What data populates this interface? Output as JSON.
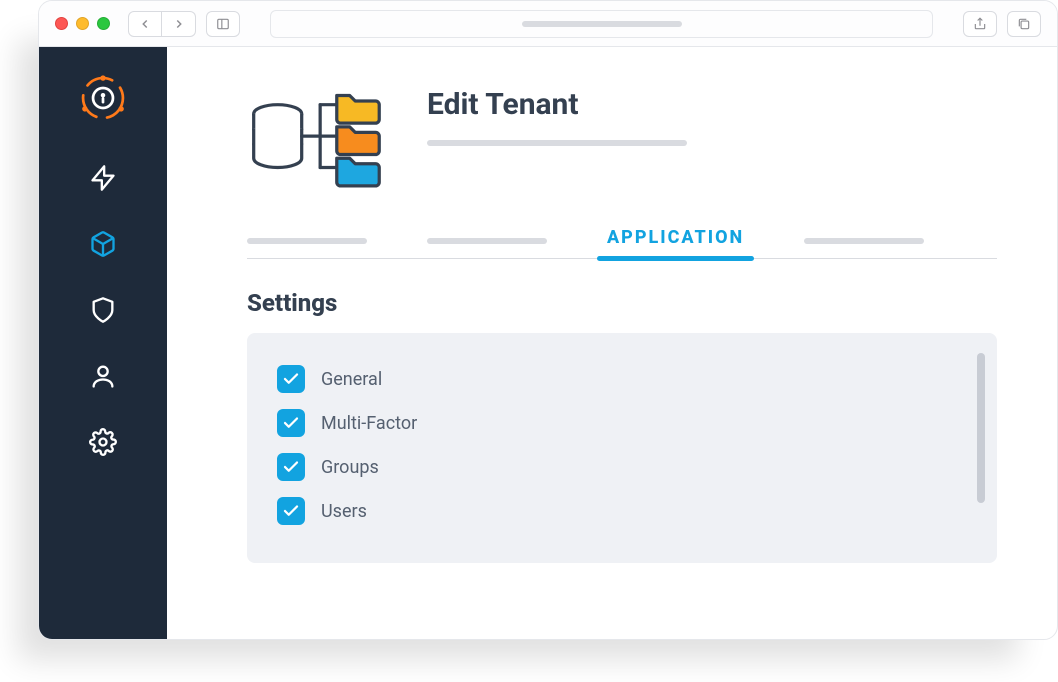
{
  "header": {
    "title": "Edit Tenant"
  },
  "tabs": {
    "active_label": "APPLICATION"
  },
  "settings": {
    "title": "Settings",
    "items": [
      {
        "label": "General",
        "checked": true
      },
      {
        "label": "Multi-Factor",
        "checked": true
      },
      {
        "label": "Groups",
        "checked": true
      },
      {
        "label": "Users",
        "checked": true
      }
    ]
  },
  "colors": {
    "accent": "#12a3e0",
    "sidebar_bg": "#1e2a3a",
    "text_primary": "#344050"
  }
}
